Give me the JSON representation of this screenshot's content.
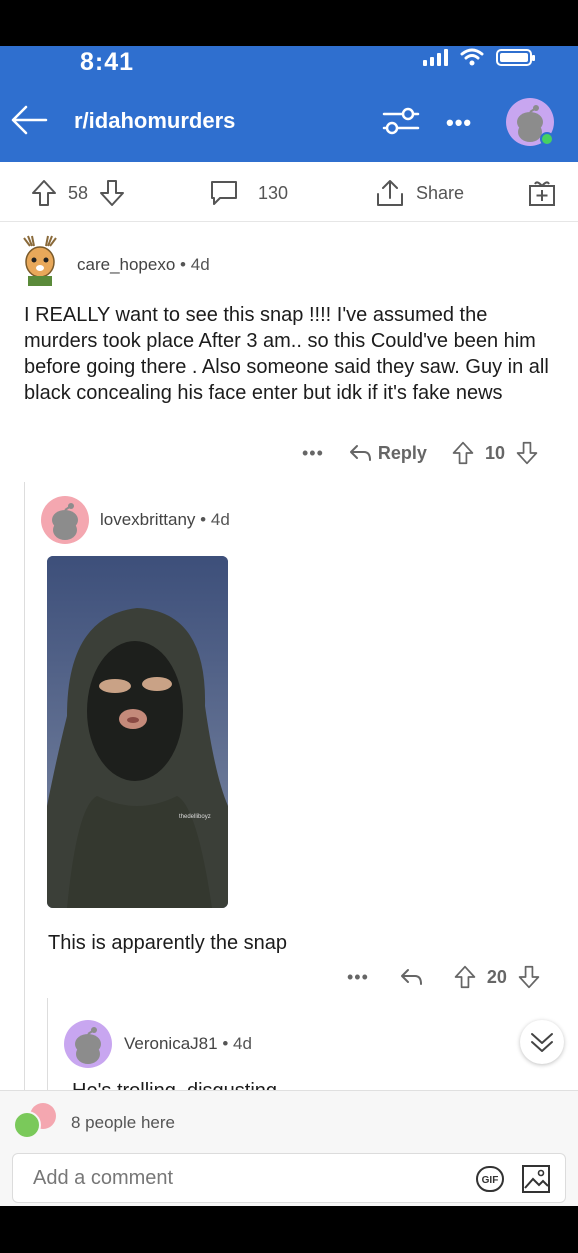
{
  "status_bar": {
    "time": "8:41"
  },
  "header": {
    "subreddit": "r/idahomurders"
  },
  "post_actions": {
    "upvotes": "58",
    "comments": "130",
    "share_label": "Share"
  },
  "comments": [
    {
      "username": "care_hopexo",
      "age": "4d",
      "body": "I REALLY want to see this snap !!!! I've assumed the murders took place After 3 am.. so this Could've been him before going there . Also someone said they saw. Guy in all black concealing his face enter but idk if it's fake news",
      "reply_label": "Reply",
      "votes": "10"
    },
    {
      "username": "lovexbrittany",
      "age": "4d",
      "image_watermark": "thedelliboyz",
      "body": "This is apparently the snap",
      "votes": "20"
    },
    {
      "username": "VeronicaJ81",
      "age": "4d",
      "body": "He's trolling, disgusting"
    }
  ],
  "presence": {
    "text": "8 people here"
  },
  "composer": {
    "placeholder": "Add a comment"
  },
  "colors": {
    "header_bg": "#2f6fcf",
    "online": "#46d160",
    "avatar_purple": "#c8a6f0",
    "avatar_pink": "#f4a7b0"
  },
  "icons": [
    "back-arrow-icon",
    "filter-icon",
    "more-icon",
    "upvote-icon",
    "downvote-icon",
    "comment-icon",
    "share-icon",
    "gift-icon",
    "reply-icon",
    "gif-icon",
    "image-icon",
    "chevron-double-down-icon"
  ]
}
